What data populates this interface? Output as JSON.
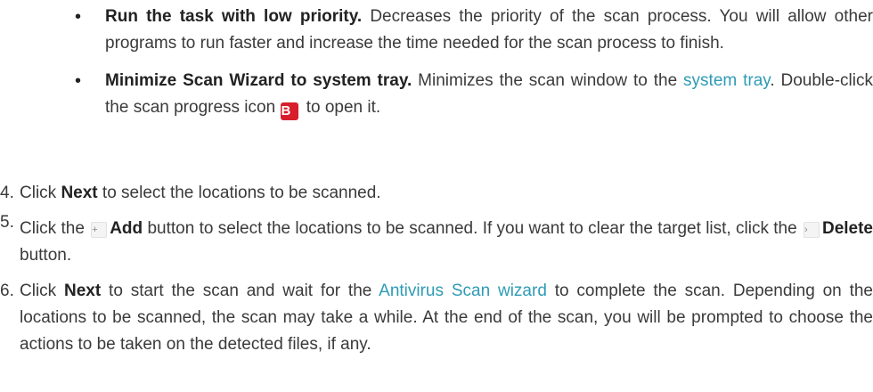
{
  "bullets": [
    {
      "title": "Run the task with low priority.",
      "text": " Decreases the priority of the scan process. You will allow other programs to run faster and increase the time needed for the scan process to finish."
    },
    {
      "title": "Minimize Scan Wizard to system tray.",
      "text_before": " Minimizes the scan window to the ",
      "link": "system tray",
      "text_mid": ". Double-click the scan progress icon ",
      "icon_letter": "B",
      "text_after": " to open it."
    }
  ],
  "steps": [
    {
      "num": "4.",
      "pre": "Click ",
      "bold": "Next",
      "post": " to select the locations to be scanned."
    },
    {
      "num": "5.",
      "pre": "Click the ",
      "add_icon": "+",
      "add_label": "Add",
      "mid": " button to select the locations to be scanned. If you want to clear the target list, click the ",
      "delete_icon": "›",
      "delete_label": "Delete",
      "post": " button."
    },
    {
      "num": "6.",
      "pre": "Click ",
      "bold": "Next",
      "mid": " to start the scan and wait for the ",
      "link": "Antivirus Scan wizard",
      "post": " to complete the scan. Depending on the locations to be scanned, the scan may take a while. At the end of the scan, you will be prompted to choose the actions to be taken on the detected files, if any."
    }
  ],
  "colors": {
    "link": "#2e9bb5",
    "icon_b": "#d81e2c",
    "text": "#3a3a3a"
  }
}
